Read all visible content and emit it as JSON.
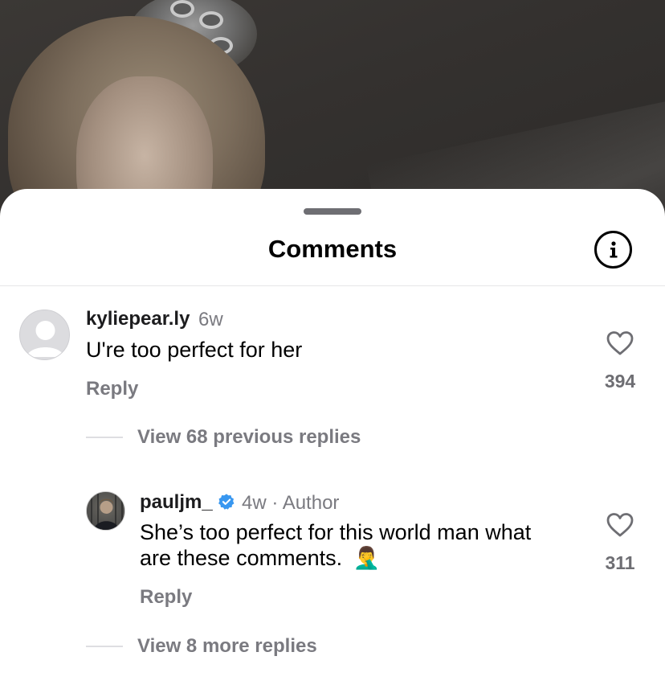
{
  "sheet": {
    "title": "Comments",
    "info_icon": "info-icon"
  },
  "comments": [
    {
      "username": "kyliepear.ly",
      "age": "6w",
      "text": "U're too perfect for her",
      "reply_label": "Reply",
      "likes": "394",
      "avatar": "default-avatar-icon"
    }
  ],
  "thread": {
    "view_previous": "View 68 previous replies",
    "view_more": "View 8 more replies"
  },
  "reply": {
    "username": "pauljm_",
    "verified_icon": "verified-badge-icon",
    "age": "4w",
    "separator": "·",
    "author_tag": "Author",
    "text_line1": "She’s too perfect for this world man what",
    "text_line2": "are these comments.",
    "emoji": "🤦‍♂️",
    "reply_label": "Reply",
    "likes": "311"
  },
  "colors": {
    "verified": "#3897f0",
    "secondary_text": "#7a7a80"
  }
}
